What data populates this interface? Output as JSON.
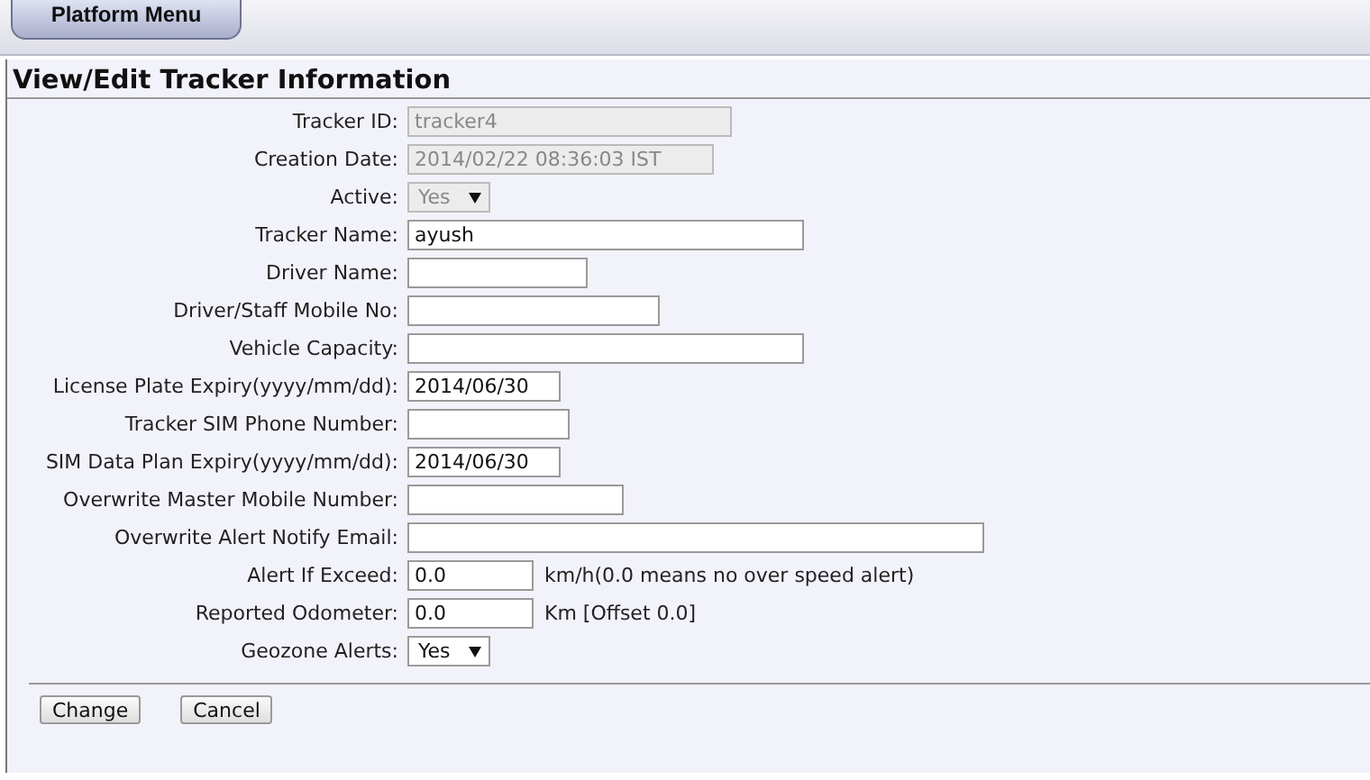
{
  "menu_tab": {
    "label": "Platform Menu",
    "selected": true
  },
  "title": "View/Edit Tracker Information",
  "fields": [
    {
      "label": "Tracker ID:",
      "kind": "text",
      "value": "tracker4",
      "disabled": true
    },
    {
      "label": "Creation Date:",
      "kind": "text",
      "value": "2014/02/22 08:36:03 IST",
      "disabled": true
    },
    {
      "label": "Active:",
      "kind": "select",
      "value": "Yes",
      "disabled": true
    },
    {
      "label": "Tracker Name:",
      "kind": "text",
      "value": "ayush",
      "disabled": false
    },
    {
      "label": "Driver Name:",
      "kind": "text",
      "disabled": false
    },
    {
      "label": "Driver/Staff Mobile No:",
      "kind": "text",
      "disabled": false
    },
    {
      "label": "Vehicle Capacity:",
      "kind": "text",
      "disabled": false
    },
    {
      "label": "License Plate Expiry(yyyy/mm/dd):",
      "kind": "text",
      "value": "2014/06/30",
      "disabled": false
    },
    {
      "label": "Tracker SIM Phone Number:",
      "kind": "text",
      "disabled": false
    },
    {
      "label": "SIM Data Plan Expiry(yyyy/mm/dd):",
      "kind": "text",
      "value": "2014/06/30",
      "disabled": false
    },
    {
      "label": "Overwrite Master Mobile Number:",
      "kind": "text",
      "disabled": false
    },
    {
      "label": "Overwrite Alert Notify Email:",
      "kind": "text",
      "disabled": false
    },
    {
      "label": "Alert If Exceed:",
      "kind": "text",
      "value": "0.0",
      "disabled": false,
      "note": "km/h(0.0 means no over speed alert)"
    },
    {
      "label": "Reported Odometer:",
      "kind": "text",
      "value": "0.0",
      "disabled": false,
      "note": "Km [Offset 0.0]"
    },
    {
      "label": "Geozone Alerts:",
      "kind": "select",
      "value": "Yes",
      "disabled": false
    }
  ],
  "buttons": [
    "Change",
    "Cancel"
  ]
}
